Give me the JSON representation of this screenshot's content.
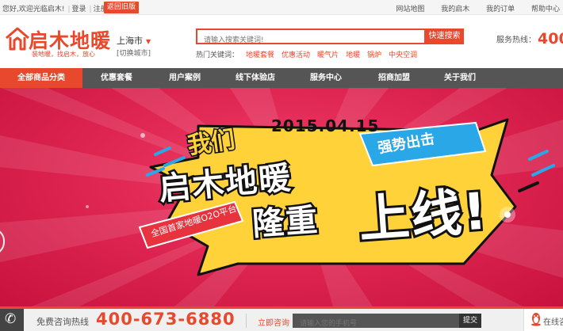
{
  "topbar": {
    "greeting": "您好,欢迎光临启木!",
    "login": "登录",
    "register": "注册",
    "old_version": "返回旧版",
    "links": [
      "网站地图",
      "我的启木",
      "我的订单",
      "帮助中心"
    ]
  },
  "header": {
    "logo_text": "启木地暖",
    "slogan": "装地暖，找启木，放心",
    "city": "上海市",
    "city_switch": "[切换城市]",
    "search_placeholder": "请输入搜索关键词!",
    "search_button": "快速搜索",
    "hot_label": "热门关键词：",
    "hot_keywords": [
      "地暖套餐",
      "优惠活动",
      "暖气片",
      "地暖",
      "锅炉",
      "中央空调"
    ],
    "hotline_label": "服务热线：",
    "hotline_number": "400"
  },
  "nav": {
    "items": [
      "全部商品分类",
      "优惠套餐",
      "用户案例",
      "线下体验店",
      "服务中心",
      "招商加盟",
      "关于我们"
    ]
  },
  "banner": {
    "women": "我们",
    "date": "2015.04.15",
    "tagline": "强势出击",
    "brand": "启木地暖",
    "long": "隆重",
    "shang": "上线",
    "exclaim": "!",
    "platform": "全国首家地暖O2O平台"
  },
  "bottom": {
    "free_label": "免费咨询热线",
    "free_number": "400-673-6880",
    "consult_label": "立即咨询",
    "phone_placeholder": "请输入您的手机号",
    "submit": "提交",
    "online": "在线咨"
  },
  "colors": {
    "accent": "#e8482c",
    "nav_bg": "#555555",
    "banner_pink": "#e02653",
    "yellow": "#ffd23a",
    "blue": "#2aa7e6"
  },
  "icons": [
    "logo-house-icon",
    "phone-icon",
    "qq-penguin-icon",
    "caret-down-icon",
    "slide-arrow-icon"
  ]
}
